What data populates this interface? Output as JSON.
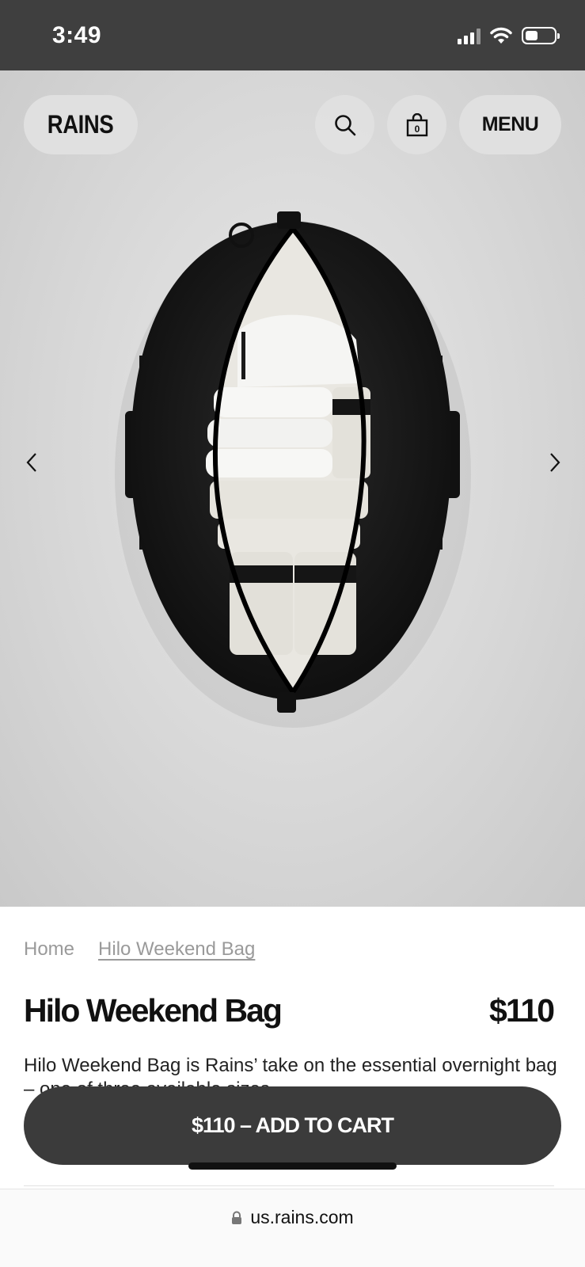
{
  "status_bar": {
    "time": "3:49",
    "battery_level": 0.45
  },
  "header": {
    "logo": "RAINS",
    "search_icon": "search-icon",
    "cart_icon": "shopping-bag-icon",
    "cart_count": "0",
    "menu_label": "MENU"
  },
  "gallery": {
    "image": "black duffel bag open showing folded white towels",
    "prev_icon": "chevron-left-icon",
    "next_icon": "chevron-right-icon"
  },
  "breadcrumb": {
    "home": "Home",
    "current": "Hilo Weekend Bag"
  },
  "product": {
    "title": "Hilo Weekend Bag",
    "price": "$110",
    "description": "Hilo Weekend Bag is Rains’ take on the essential overnight bag – one of three available sizes."
  },
  "cta": {
    "label": "$110 – ADD TO CART"
  },
  "browser": {
    "lock_icon": "lock-icon",
    "url": "us.rains.com"
  },
  "colors": {
    "status_bar": "#3f3f3f",
    "cta_bg": "#3b3b3b",
    "hero_bg": "#d6d6d6"
  }
}
